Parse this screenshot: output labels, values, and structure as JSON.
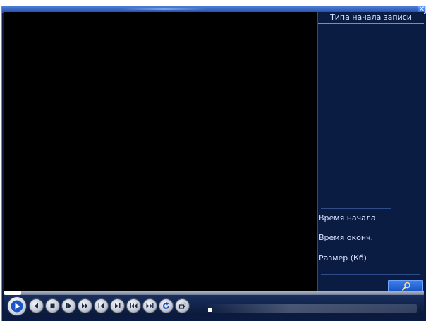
{
  "window": {
    "close_glyph": "✕"
  },
  "side_panel": {
    "header": "Типа начала записи",
    "start_time_label": "Время начала",
    "end_time_label": "Время оконч.",
    "size_label": "Размер (Кб)",
    "search_icon": "search-icon"
  },
  "playback": {
    "progress_fraction": 0.0,
    "buttons": [
      {
        "name": "play",
        "icon": "play-icon"
      },
      {
        "name": "frame-back",
        "icon": "reverse-play-icon"
      },
      {
        "name": "stop",
        "icon": "stop-icon"
      },
      {
        "name": "slow-play",
        "icon": "slow-play-icon"
      },
      {
        "name": "fast-forward",
        "icon": "fast-forward-icon"
      },
      {
        "name": "previous-frame",
        "icon": "previous-frame-icon"
      },
      {
        "name": "next-frame",
        "icon": "next-frame-icon"
      },
      {
        "name": "previous-file",
        "icon": "previous-file-icon"
      },
      {
        "name": "next-file",
        "icon": "next-file-icon"
      },
      {
        "name": "refresh",
        "icon": "refresh-icon"
      },
      {
        "name": "backup",
        "icon": "backup-icon"
      }
    ]
  },
  "colors": {
    "accent": "#2462d8",
    "panel_bg": "#0b1c43",
    "video_bg": "#000000",
    "text": "#d8e3ff"
  }
}
